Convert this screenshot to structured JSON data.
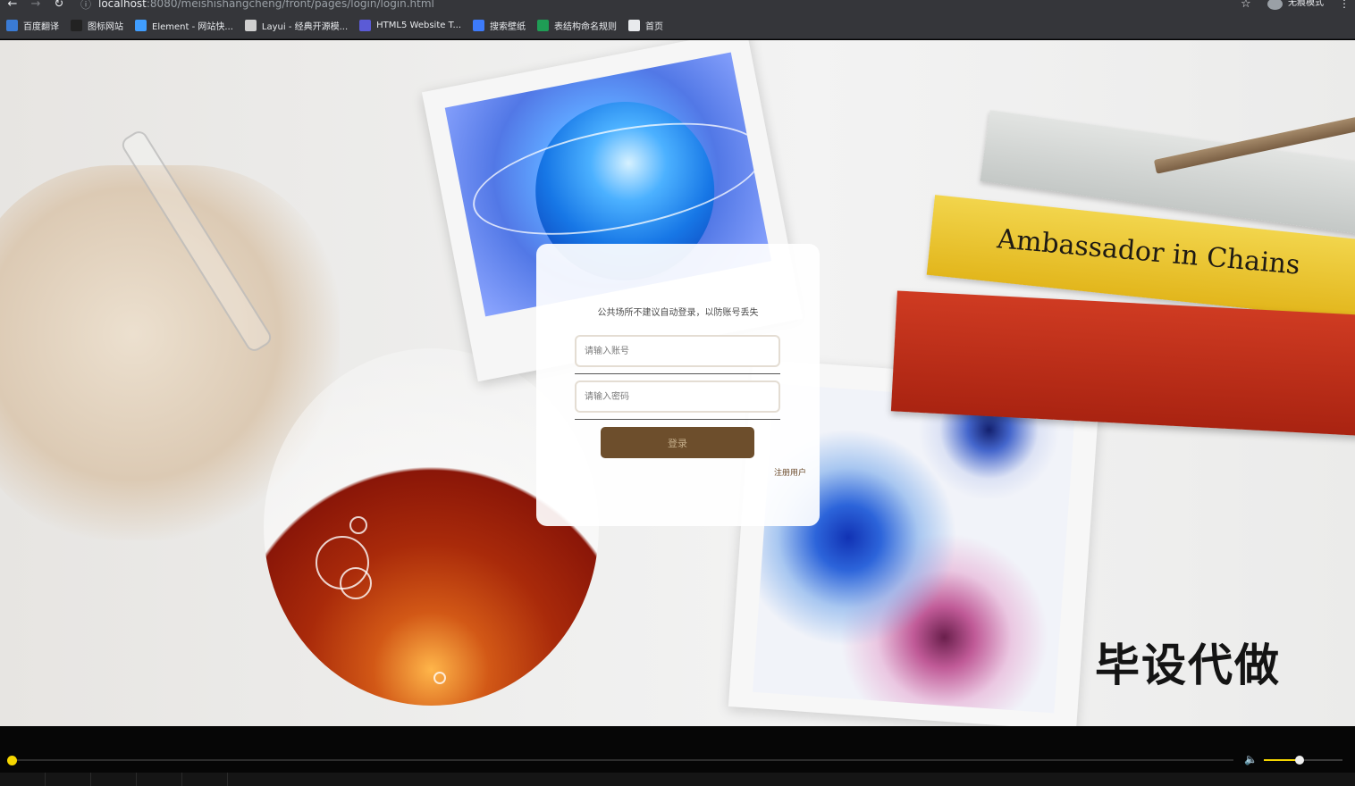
{
  "browser": {
    "url_host": "localhost",
    "url_path": ":8080/meishishangcheng/front/pages/login/login.html",
    "incognito_label": "无痕模式",
    "bookmarks": [
      {
        "label": "百度翻译",
        "icon": "translate-icon",
        "color": "#3a7bd5"
      },
      {
        "label": "图标网站",
        "icon": "flag-icon",
        "color": "#222222"
      },
      {
        "label": "Element - 网站快...",
        "icon": "element-icon",
        "color": "#409eff"
      },
      {
        "label": "Layui - 经典开源模...",
        "icon": "layui-icon",
        "color": "#cfcfcf"
      },
      {
        "label": "HTML5 Website T...",
        "icon": "html5-icon",
        "color": "#5b5bd6"
      },
      {
        "label": "搜索壁纸",
        "icon": "wallpaper-icon",
        "color": "#3d7bfa"
      },
      {
        "label": "表结构命名规则",
        "icon": "table-icon",
        "color": "#1f9d55"
      },
      {
        "label": "首页",
        "icon": "globe-icon",
        "color": "#e8eaed"
      }
    ]
  },
  "login": {
    "notice": "公共场所不建议自动登录，以防账号丢失",
    "account_placeholder": "请输入账号",
    "password_placeholder": "请输入密码",
    "login_button": "登录",
    "register_link": "注册用户"
  },
  "background": {
    "book_title": "Ambassador in Chains",
    "watermark": "毕设代做"
  },
  "player": {
    "progress": 0.0,
    "volume": 0.45,
    "accent_color": "#f5d600"
  }
}
